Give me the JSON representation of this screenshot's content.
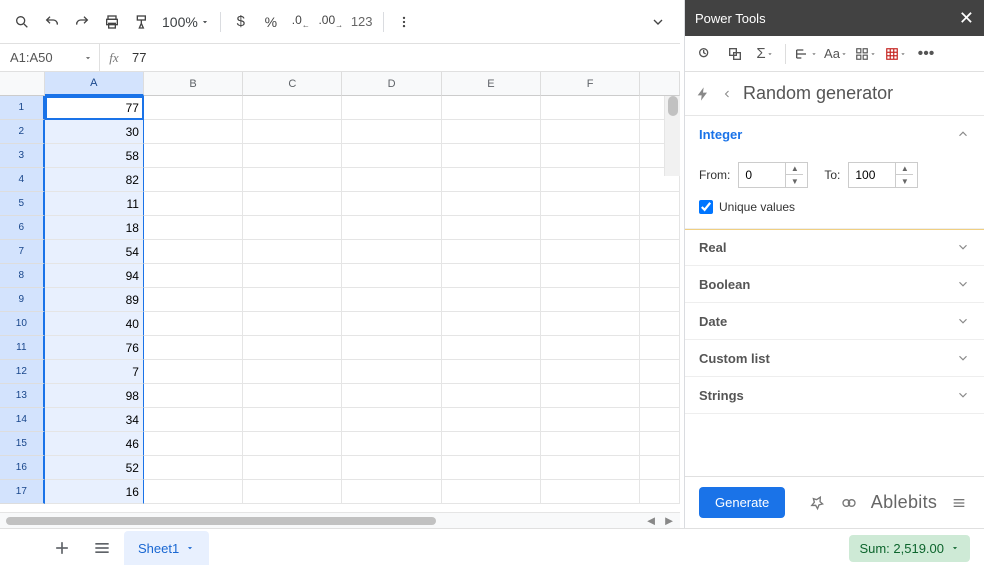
{
  "toolbar": {
    "zoom_label": "100%",
    "format123": "123"
  },
  "namebox": {
    "ref": "A1:A50"
  },
  "formula_bar": {
    "value": "77"
  },
  "columns": [
    "A",
    "B",
    "C",
    "D",
    "E",
    "F"
  ],
  "rows": [
    {
      "n": "1",
      "a": "77"
    },
    {
      "n": "2",
      "a": "30"
    },
    {
      "n": "3",
      "a": "58"
    },
    {
      "n": "4",
      "a": "82"
    },
    {
      "n": "5",
      "a": "11"
    },
    {
      "n": "6",
      "a": "18"
    },
    {
      "n": "7",
      "a": "54"
    },
    {
      "n": "8",
      "a": "94"
    },
    {
      "n": "9",
      "a": "89"
    },
    {
      "n": "10",
      "a": "40"
    },
    {
      "n": "11",
      "a": "76"
    },
    {
      "n": "12",
      "a": "7"
    },
    {
      "n": "13",
      "a": "98"
    },
    {
      "n": "14",
      "a": "34"
    },
    {
      "n": "15",
      "a": "46"
    },
    {
      "n": "16",
      "a": "52"
    },
    {
      "n": "17",
      "a": "16"
    }
  ],
  "sheet_tab": {
    "name": "Sheet1"
  },
  "status_bar": {
    "summary": "Sum: 2,519.00"
  },
  "panel": {
    "title": "Power Tools",
    "breadcrumb": "Random generator",
    "accordion": {
      "integer": {
        "label": "Integer",
        "from_label": "From:",
        "from_value": "0",
        "to_label": "To:",
        "to_value": "100",
        "unique_label": "Unique values",
        "unique_checked": true
      },
      "real": "Real",
      "boolean": "Boolean",
      "date": "Date",
      "custom_list": "Custom list",
      "strings": "Strings"
    },
    "generate_label": "Generate",
    "brand": "Ablebits"
  }
}
